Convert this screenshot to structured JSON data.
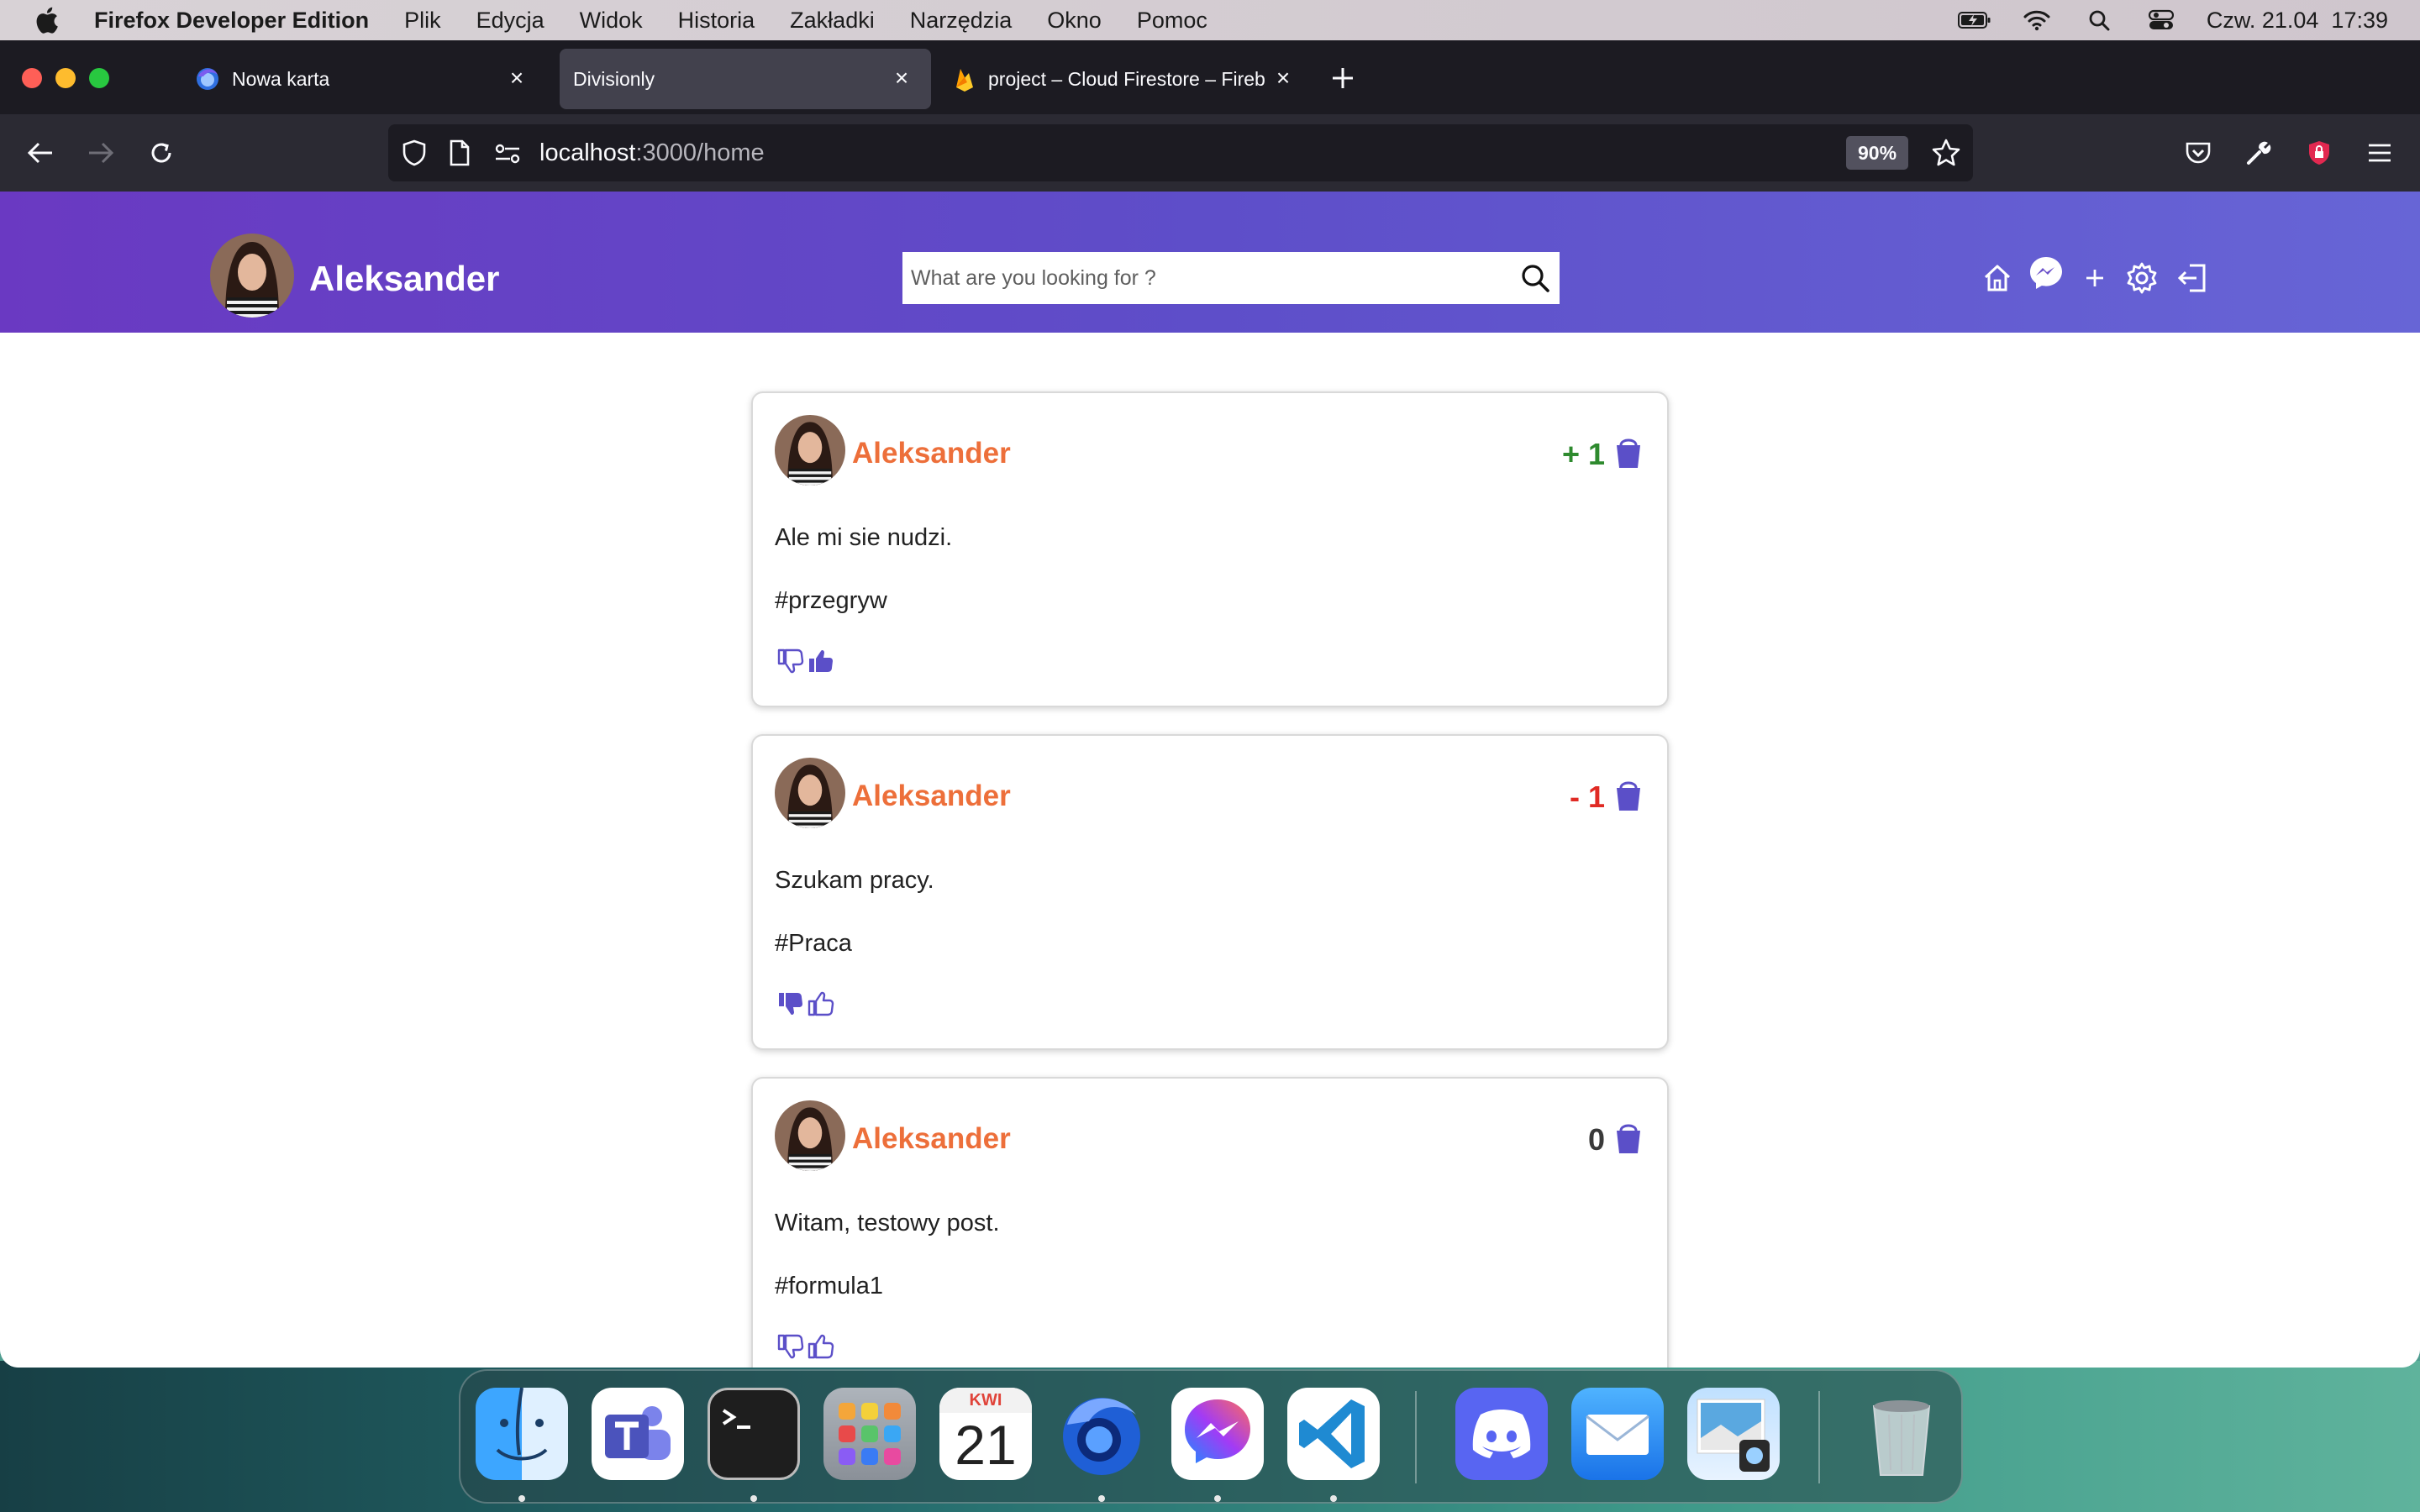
{
  "menubar": {
    "app_name": "Firefox Developer Edition",
    "items": [
      "Plik",
      "Edycja",
      "Widok",
      "Historia",
      "Zakładki",
      "Narzędzia",
      "Okno",
      "Pomoc"
    ],
    "datetime": "Czw. 21.04  17:39"
  },
  "browser": {
    "tabs": [
      {
        "label": "Nowa karta",
        "icon": "firefox-icon"
      },
      {
        "label": "Divisionly",
        "icon": "none"
      },
      {
        "label": "project – Cloud Firestore – Fireb",
        "icon": "firebase-icon"
      }
    ],
    "url_host": "localhost",
    "url_path": ":3000/home",
    "zoom": "90%"
  },
  "header": {
    "username": "Aleksander",
    "search_placeholder": "What are you looking for ?"
  },
  "posts": [
    {
      "author": "Aleksander",
      "score": "+ 1",
      "text": "Ale mi sie nudzi.",
      "tag": "#przegryw",
      "vote": "up"
    },
    {
      "author": "Aleksander",
      "score": "- 1",
      "text": "Szukam pracy.",
      "tag": "#Praca",
      "vote": "down"
    },
    {
      "author": "Aleksander",
      "score": "0",
      "text": "Witam, testowy post.",
      "tag": "#formula1",
      "vote": "none"
    }
  ],
  "dock": {
    "calendar_month": "KWI",
    "calendar_day": "21",
    "apps": [
      "finder-icon",
      "teams-icon",
      "terminal-icon",
      "launchpad-icon",
      "calendar-icon",
      "firefox-icon",
      "messenger-icon",
      "vscode-icon",
      "discord-icon",
      "mail-icon",
      "preview-icon",
      "trash-icon"
    ]
  },
  "colors": {
    "header_gradient_start": "#6a39c2",
    "header_gradient_end": "#6765d6",
    "author": "#ed6f3a",
    "score_positive": "#2e8a2e",
    "score_negative": "#e02a24",
    "icon_accent": "#5b4fc8"
  }
}
